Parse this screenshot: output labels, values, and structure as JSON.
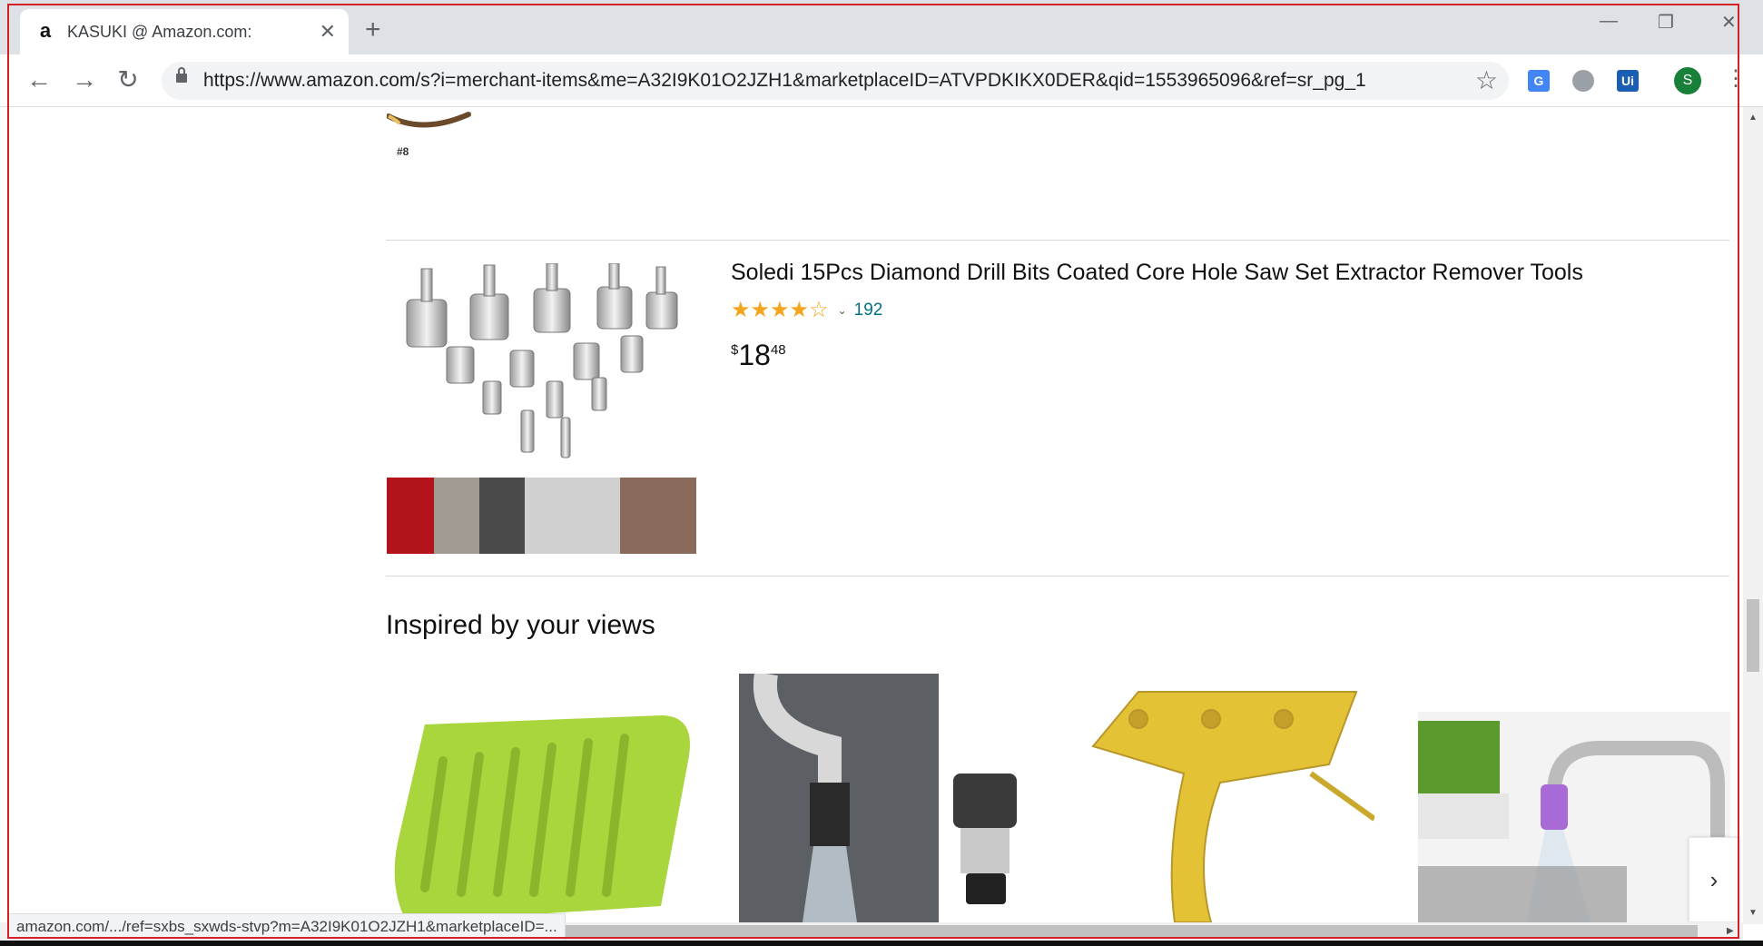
{
  "browser": {
    "tab_title": "KASUKI @ Amazon.com:",
    "favicon_letter": "a",
    "tab_close_glyph": "✕",
    "new_tab_glyph": "+",
    "url": "https://www.amazon.com/s?i=merchant-items&me=A32I9K01O2JZH1&marketplaceID=ATVPDKIKX0DER&qid=1553965096&ref=sr_pg_1",
    "back_glyph": "←",
    "forward_glyph": "→",
    "reload_glyph": "↻",
    "bookmark_glyph": "☆",
    "profile_initial": "S",
    "menu_glyph": "⋮",
    "extensions": [
      {
        "name": "google-translate-extension",
        "text": "G",
        "color": "#4285f4"
      },
      {
        "name": "globe-extension",
        "text": "",
        "color": "#9aa0a6"
      },
      {
        "name": "uipath-extension",
        "text": "Ui",
        "color": "#1a5fb4"
      }
    ],
    "window_controls": {
      "minimize": "—",
      "restore": "❐",
      "close": "✕"
    },
    "status_url": "amazon.com/.../ref=sxbs_sxwds-stvp?m=A32I9K01O2JZH1&marketplaceID=..."
  },
  "previous_item": {
    "rank": "#8"
  },
  "product": {
    "title": "Soledi 15Pcs Diamond Drill Bits Coated Core Hole Saw Set Extractor Remover Tools",
    "rating": 3.5,
    "stars_display": [
      "★",
      "★",
      "★",
      "★",
      "☆"
    ],
    "rating_count": "192",
    "rating_chevron": "⌄",
    "price_symbol": "$",
    "price_whole": "18",
    "price_fraction": "48"
  },
  "inspired": {
    "heading": "Inspired by your views",
    "next_arrow": "›",
    "items": [
      {
        "name": "soap-dish-green",
        "color": "#a4d53a"
      },
      {
        "name": "faucet-aerator",
        "color": "#7d7d7d"
      },
      {
        "name": "brass-hanger-hook",
        "color": "#e6c23a"
      },
      {
        "name": "faucet-sprayer-purple",
        "color": "#a86ad6"
      }
    ]
  },
  "colors": {
    "link": "#007185",
    "star": "#f4a41d",
    "outline": "#d61f26"
  }
}
